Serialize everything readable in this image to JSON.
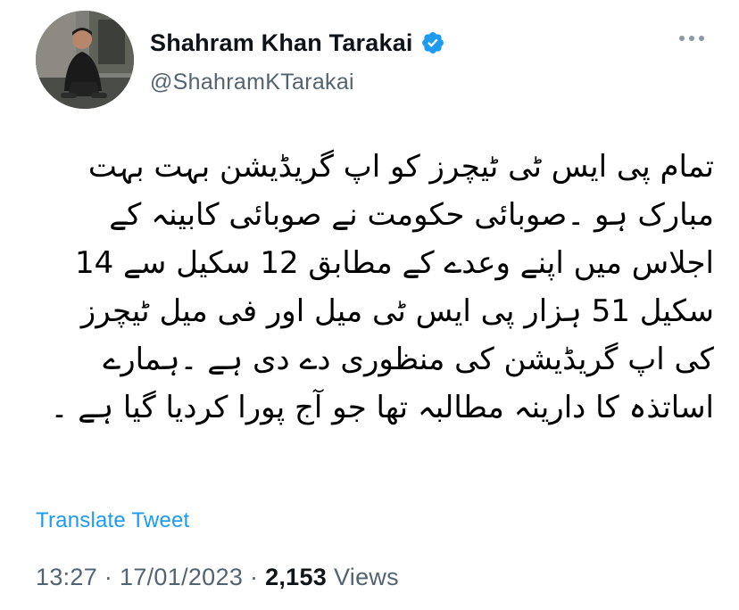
{
  "author": {
    "display_name": "Shahram Khan Tarakai",
    "handle": "@ShahramKTarakai",
    "verified_icon": "verified-badge-icon",
    "avatar_icon": "profile-photo"
  },
  "more_icon": "more-options-icon",
  "tweet": {
    "text": "تمام پی ایس ٹی ٹیچرز کو اپ گریڈیشن بہت بہت مبارک ہو ۔صوبائی حکومت نے صوبائی کابینہ کے اجلاس میں اپنے وعدے کے مطابق 12 سکیل سے 14 سکیل 51 ہزار پی ایس ٹی میل اور فی میل ٹیچرز کی اپ گریڈیشن کی منظوری دے دی ہے ۔ہمارے اساتذہ کا دارینہ مطالبہ تھا جو آج پورا کردیا گیا ہے ۔",
    "translate_label": "Translate Tweet",
    "time": "13:27",
    "separator": "·",
    "date": "17/01/2023",
    "views_count": "2,153",
    "views_label": "Views"
  },
  "colors": {
    "link": "#1d9bf0",
    "muted": "#536471",
    "text": "#0f1419",
    "verified": "#1d9bf0"
  }
}
